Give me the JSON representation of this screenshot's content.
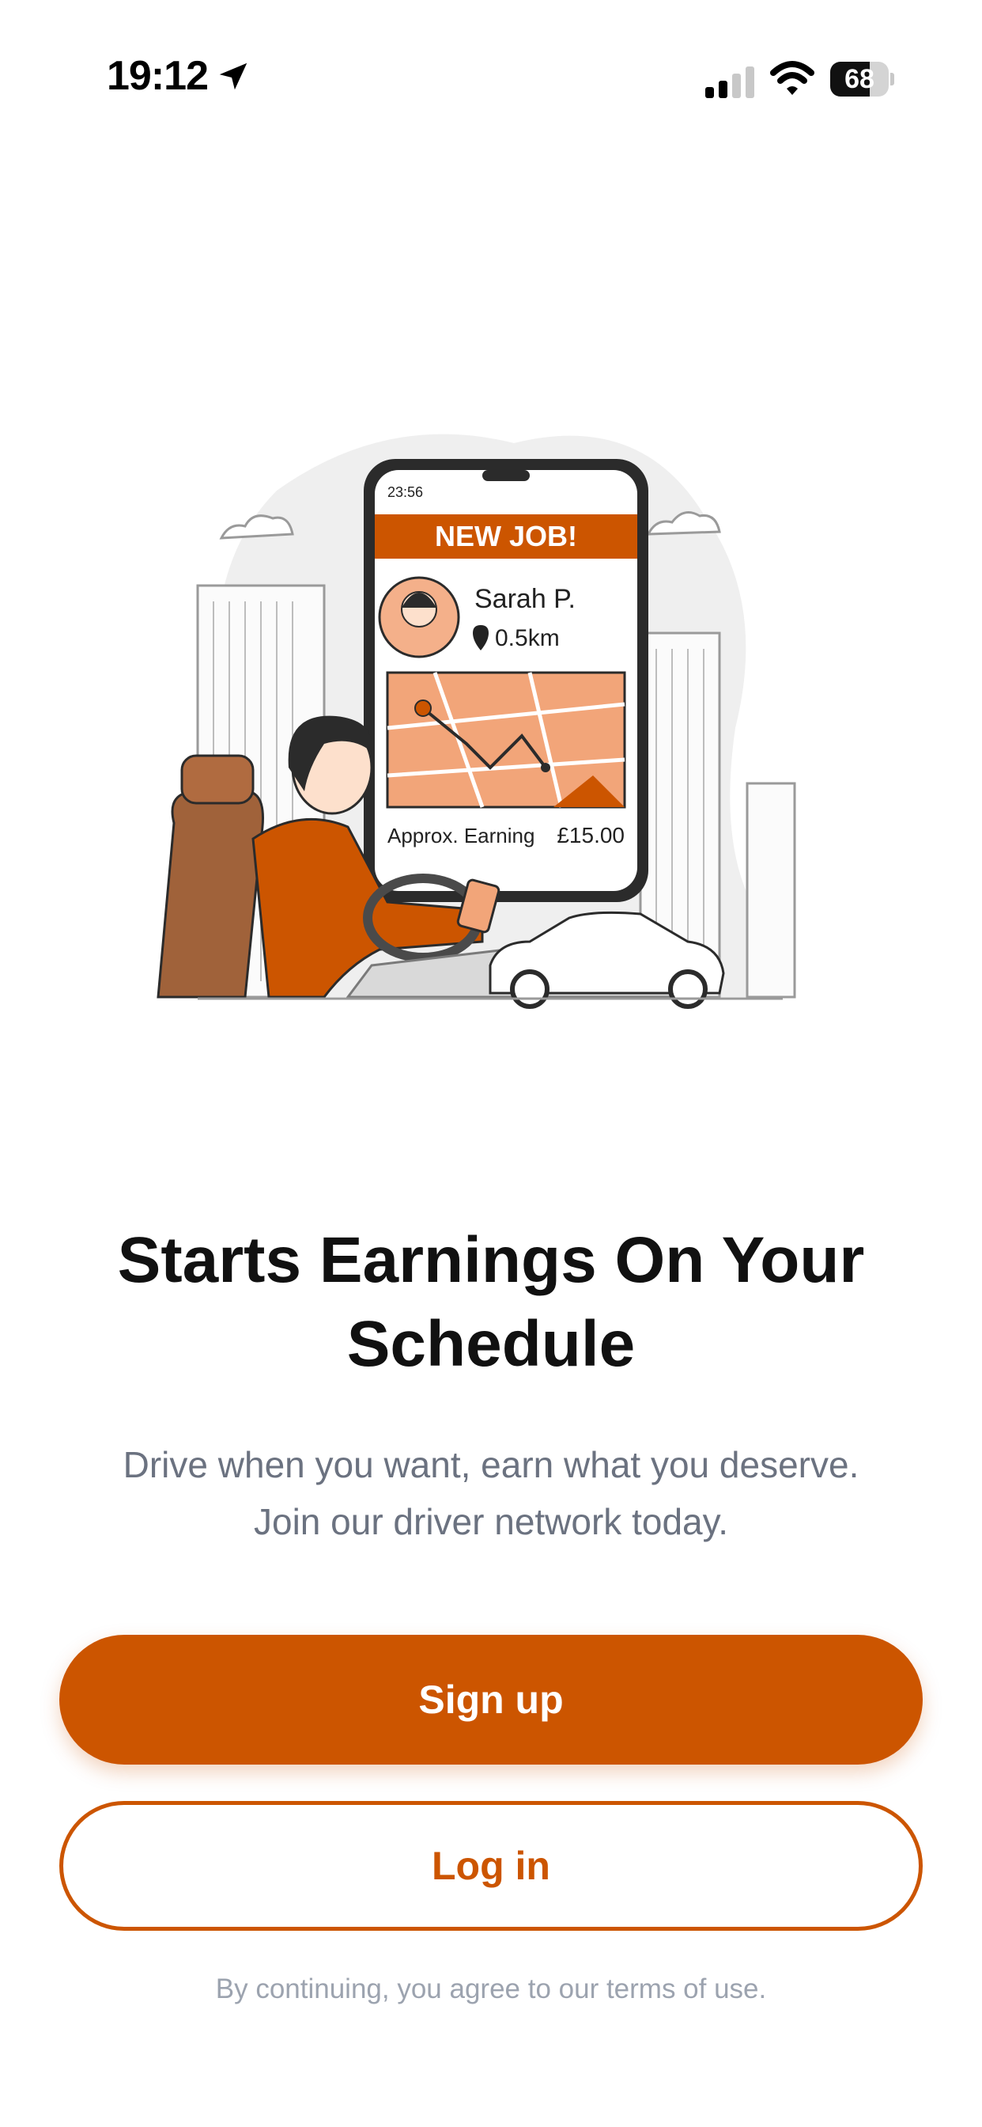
{
  "status_bar": {
    "time": "19:12",
    "battery_percent": "68",
    "battery_level": 0.68,
    "icons": [
      "location-arrow-icon",
      "cellular-signal-icon",
      "wifi-icon",
      "battery-icon"
    ]
  },
  "illustration": {
    "phone_time": "23:56",
    "banner": "NEW JOB!",
    "passenger_name": "Sarah P.",
    "distance": "0.5km",
    "earning_label": "Approx. Earning",
    "earning_value": "£15.00"
  },
  "onboarding": {
    "headline_line1": "Starts Earnings On Your",
    "headline_line2": "Schedule",
    "subtitle_line1": "Drive when you want, earn what you deserve.",
    "subtitle_line2": "Join our driver network today."
  },
  "actions": {
    "signup_label": "Sign up",
    "login_label": "Log in"
  },
  "footer": {
    "terms": "By continuing, you agree to our terms of use."
  },
  "colors": {
    "accent": "#cc5500",
    "muted_text": "#6b7280",
    "terms_text": "#9ca3af"
  }
}
